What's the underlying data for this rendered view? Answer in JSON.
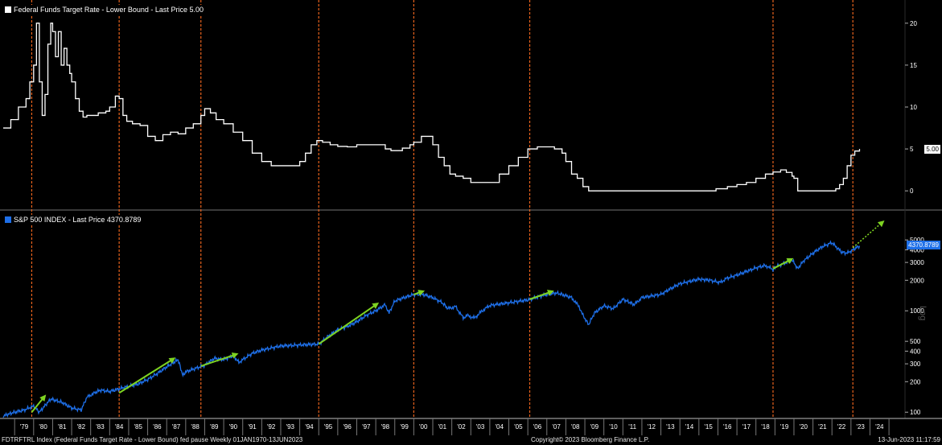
{
  "chart_data": [
    {
      "type": "line",
      "title": "Federal Funds Target Rate - Lower Bound - Last Price 5.00",
      "last_price_label": "5.00",
      "y_ticks": [
        0,
        5,
        10,
        15,
        20
      ],
      "ylim": [
        -2,
        22
      ],
      "xlim": [
        1978.4,
        2025.8
      ],
      "x": [
        1978.4,
        1978.8,
        1979.2,
        1979.6,
        1979.8,
        1980.0,
        1980.15,
        1980.3,
        1980.45,
        1980.6,
        1980.75,
        1980.9,
        1981.0,
        1981.15,
        1981.3,
        1981.45,
        1981.6,
        1981.75,
        1981.9,
        1982.0,
        1982.2,
        1982.4,
        1982.6,
        1982.8,
        1983.0,
        1983.4,
        1983.8,
        1984.0,
        1984.3,
        1984.5,
        1984.7,
        1984.9,
        1985.2,
        1985.6,
        1986.0,
        1986.4,
        1986.8,
        1987.2,
        1987.6,
        1988.0,
        1988.4,
        1988.8,
        1989.0,
        1989.3,
        1989.6,
        1990.0,
        1990.5,
        1991.0,
        1991.5,
        1992.0,
        1992.5,
        1993.0,
        1993.5,
        1994.0,
        1994.3,
        1994.6,
        1994.9,
        1995.2,
        1995.6,
        1996.0,
        1996.5,
        1997.0,
        1997.5,
        1998.0,
        1998.5,
        1998.8,
        1999.0,
        1999.4,
        1999.8,
        2000.0,
        2000.4,
        2000.8,
        2001.0,
        2001.3,
        2001.6,
        2001.9,
        2002.2,
        2002.6,
        2003.0,
        2003.5,
        2004.0,
        2004.5,
        2005.0,
        2005.5,
        2006.0,
        2006.5,
        2007.0,
        2007.4,
        2007.8,
        2008.0,
        2008.3,
        2008.6,
        2008.9,
        2009.2,
        2010,
        2011,
        2012,
        2013,
        2014,
        2015,
        2015.9,
        2016.5,
        2017.0,
        2017.5,
        2018.0,
        2018.5,
        2018.9,
        2019.3,
        2019.6,
        2019.9,
        2020.0,
        2020.2,
        2020.5,
        2021,
        2021.5,
        2022.0,
        2022.2,
        2022.4,
        2022.6,
        2022.8,
        2023.0,
        2023.2,
        2023.45
      ],
      "y": [
        7.5,
        8.5,
        10.0,
        11.0,
        13.0,
        15.0,
        20.0,
        13.0,
        9.0,
        11.5,
        17.5,
        20.0,
        19.0,
        16.0,
        19.0,
        15.0,
        17.0,
        15.0,
        14.0,
        13.0,
        11.0,
        9.5,
        8.8,
        9.0,
        9.0,
        9.3,
        9.5,
        10.0,
        11.3,
        11.0,
        9.0,
        8.3,
        8.0,
        7.8,
        6.5,
        6.0,
        6.7,
        7.0,
        6.8,
        7.5,
        8.0,
        9.0,
        9.8,
        9.3,
        8.5,
        8.0,
        7.0,
        6.0,
        4.5,
        3.5,
        3.0,
        3.0,
        3.0,
        3.5,
        4.5,
        5.5,
        6.0,
        5.8,
        5.5,
        5.3,
        5.25,
        5.5,
        5.5,
        5.5,
        5.0,
        4.8,
        4.8,
        5.1,
        5.5,
        5.8,
        6.5,
        6.5,
        5.5,
        4.0,
        3.0,
        2.0,
        1.75,
        1.5,
        1.0,
        1.0,
        1.0,
        2.0,
        3.0,
        4.0,
        5.0,
        5.25,
        5.25,
        5.0,
        4.5,
        3.5,
        2.0,
        1.5,
        0.5,
        0,
        0,
        0,
        0,
        0,
        0,
        0,
        0.25,
        0.5,
        0.75,
        1.0,
        1.5,
        2.0,
        2.25,
        2.5,
        2.2,
        1.75,
        1.5,
        0,
        0,
        0,
        0,
        0,
        0.25,
        0.75,
        1.5,
        3.0,
        4.25,
        4.75,
        5.0
      ],
      "vlines": [
        1979.9,
        1984.5,
        1988.8,
        1995.0,
        2000.0,
        2006.1,
        2018.9,
        2023.1
      ]
    },
    {
      "type": "line",
      "title": "S&P 500 INDEX - Last Price 4370.8789",
      "last_price_label": "4370.8789",
      "scale": "log",
      "y_ticks": [
        100,
        200,
        300,
        400,
        500,
        1000,
        2000,
        3000,
        4000,
        5000
      ],
      "ylim": [
        90,
        9000
      ],
      "xlim": [
        1978.4,
        2025.8
      ],
      "x": [
        1978.4,
        1979.0,
        1979.5,
        1980.0,
        1980.3,
        1980.9,
        1981.5,
        1982.0,
        1982.5,
        1982.8,
        1983.2,
        1983.5,
        1984.0,
        1984.5,
        1985.0,
        1985.5,
        1986.0,
        1986.5,
        1987.0,
        1987.6,
        1987.85,
        1988.0,
        1988.5,
        1989.0,
        1989.5,
        1990.0,
        1990.5,
        1990.8,
        1991.0,
        1991.5,
        1992.0,
        1993.0,
        1994.0,
        1995.0,
        1995.5,
        1996.0,
        1996.5,
        1997.0,
        1997.5,
        1998.0,
        1998.5,
        1998.7,
        1999.0,
        1999.5,
        2000.0,
        2000.5,
        2001.0,
        2001.5,
        2001.8,
        2002.2,
        2002.6,
        2002.8,
        2003.2,
        2003.6,
        2004.0,
        2005.0,
        2006.0,
        2007.0,
        2007.5,
        2007.8,
        2008.3,
        2008.7,
        2008.9,
        2009.2,
        2009.5,
        2010.0,
        2010.5,
        2011.0,
        2011.6,
        2012.0,
        2012.5,
        2013.0,
        2013.5,
        2014.0,
        2015.0,
        2015.6,
        2016.1,
        2016.5,
        2017.0,
        2018.0,
        2018.5,
        2018.9,
        2019.0,
        2019.5,
        2019.9,
        2020.2,
        2020.5,
        2021.0,
        2021.5,
        2022.0,
        2022.5,
        2022.8,
        2023.0,
        2023.45
      ],
      "y": [
        92,
        100,
        105,
        115,
        100,
        135,
        125,
        110,
        105,
        140,
        155,
        165,
        160,
        170,
        180,
        190,
        210,
        240,
        280,
        330,
        230,
        250,
        270,
        290,
        340,
        330,
        360,
        310,
        330,
        380,
        410,
        450,
        460,
        470,
        560,
        650,
        700,
        780,
        900,
        1000,
        1150,
        950,
        1250,
        1350,
        1450,
        1450,
        1350,
        1200,
        1050,
        1100,
        850,
        900,
        850,
        1000,
        1130,
        1200,
        1280,
        1450,
        1500,
        1450,
        1350,
        1100,
        900,
        730,
        950,
        1120,
        1050,
        1300,
        1150,
        1350,
        1400,
        1450,
        1650,
        1850,
        2050,
        2000,
        1900,
        2100,
        2250,
        2650,
        2800,
        2550,
        2700,
        2950,
        3200,
        2600,
        3100,
        3700,
        4300,
        4700,
        3800,
        3700,
        3900,
        4370
      ]
    }
  ],
  "arrows": [
    {
      "x": [
        1979.9,
        1980.6
      ],
      "y": [
        100,
        145
      ]
    },
    {
      "x": [
        1984.5,
        1987.4
      ],
      "y": [
        155,
        340
      ]
    },
    {
      "x": [
        1988.8,
        1990.7
      ],
      "y": [
        285,
        375
      ]
    },
    {
      "x": [
        1995.0,
        1998.1
      ],
      "y": [
        470,
        1180
      ]
    },
    {
      "x": [
        2000.0,
        2000.5
      ],
      "y": [
        1450,
        1560
      ]
    },
    {
      "x": [
        2006.1,
        2007.3
      ],
      "y": [
        1300,
        1560
      ]
    },
    {
      "x": [
        2018.9,
        2019.9
      ],
      "y": [
        2600,
        3250
      ]
    }
  ],
  "projection": {
    "x": [
      2023.1,
      2024.7
    ],
    "y": [
      4200,
      7600
    ]
  },
  "x_axis_labels": [
    "'79",
    "'80",
    "'81",
    "'82",
    "'83",
    "'84",
    "'85",
    "'86",
    "'87",
    "'88",
    "'89",
    "'90",
    "'91",
    "'92",
    "'93",
    "'94",
    "'95",
    "'96",
    "'97",
    "'98",
    "'99",
    "'00",
    "'01",
    "'02",
    "'03",
    "'04",
    "'05",
    "'06",
    "'07",
    "'08",
    "'09",
    "'10",
    "'11",
    "'12",
    "'13",
    "'14",
    "'15",
    "'16",
    "'17",
    "'18",
    "'19",
    "'20",
    "'21",
    "'22",
    "'23",
    "'24"
  ],
  "x_axis_start_year": 1979,
  "footer_left": "FDTRFTRL Index (Federal Funds Target Rate - Lower Bound) fed pause  Weekly 01JAN1970-13JUN2023",
  "footer_center": "Copyright© 2023 Bloomberg Finance L.P.",
  "footer_right": "13-Jun-2023 11:17:59",
  "log_label": "Log",
  "colors": {
    "fed_line": "#ffffff",
    "spx_line": "#1e6fe8",
    "arrow": "#7ed321",
    "vline": "#e8621c",
    "fed_badge_bg": "#ffffff",
    "spx_badge_bg": "#1e6fe8"
  }
}
